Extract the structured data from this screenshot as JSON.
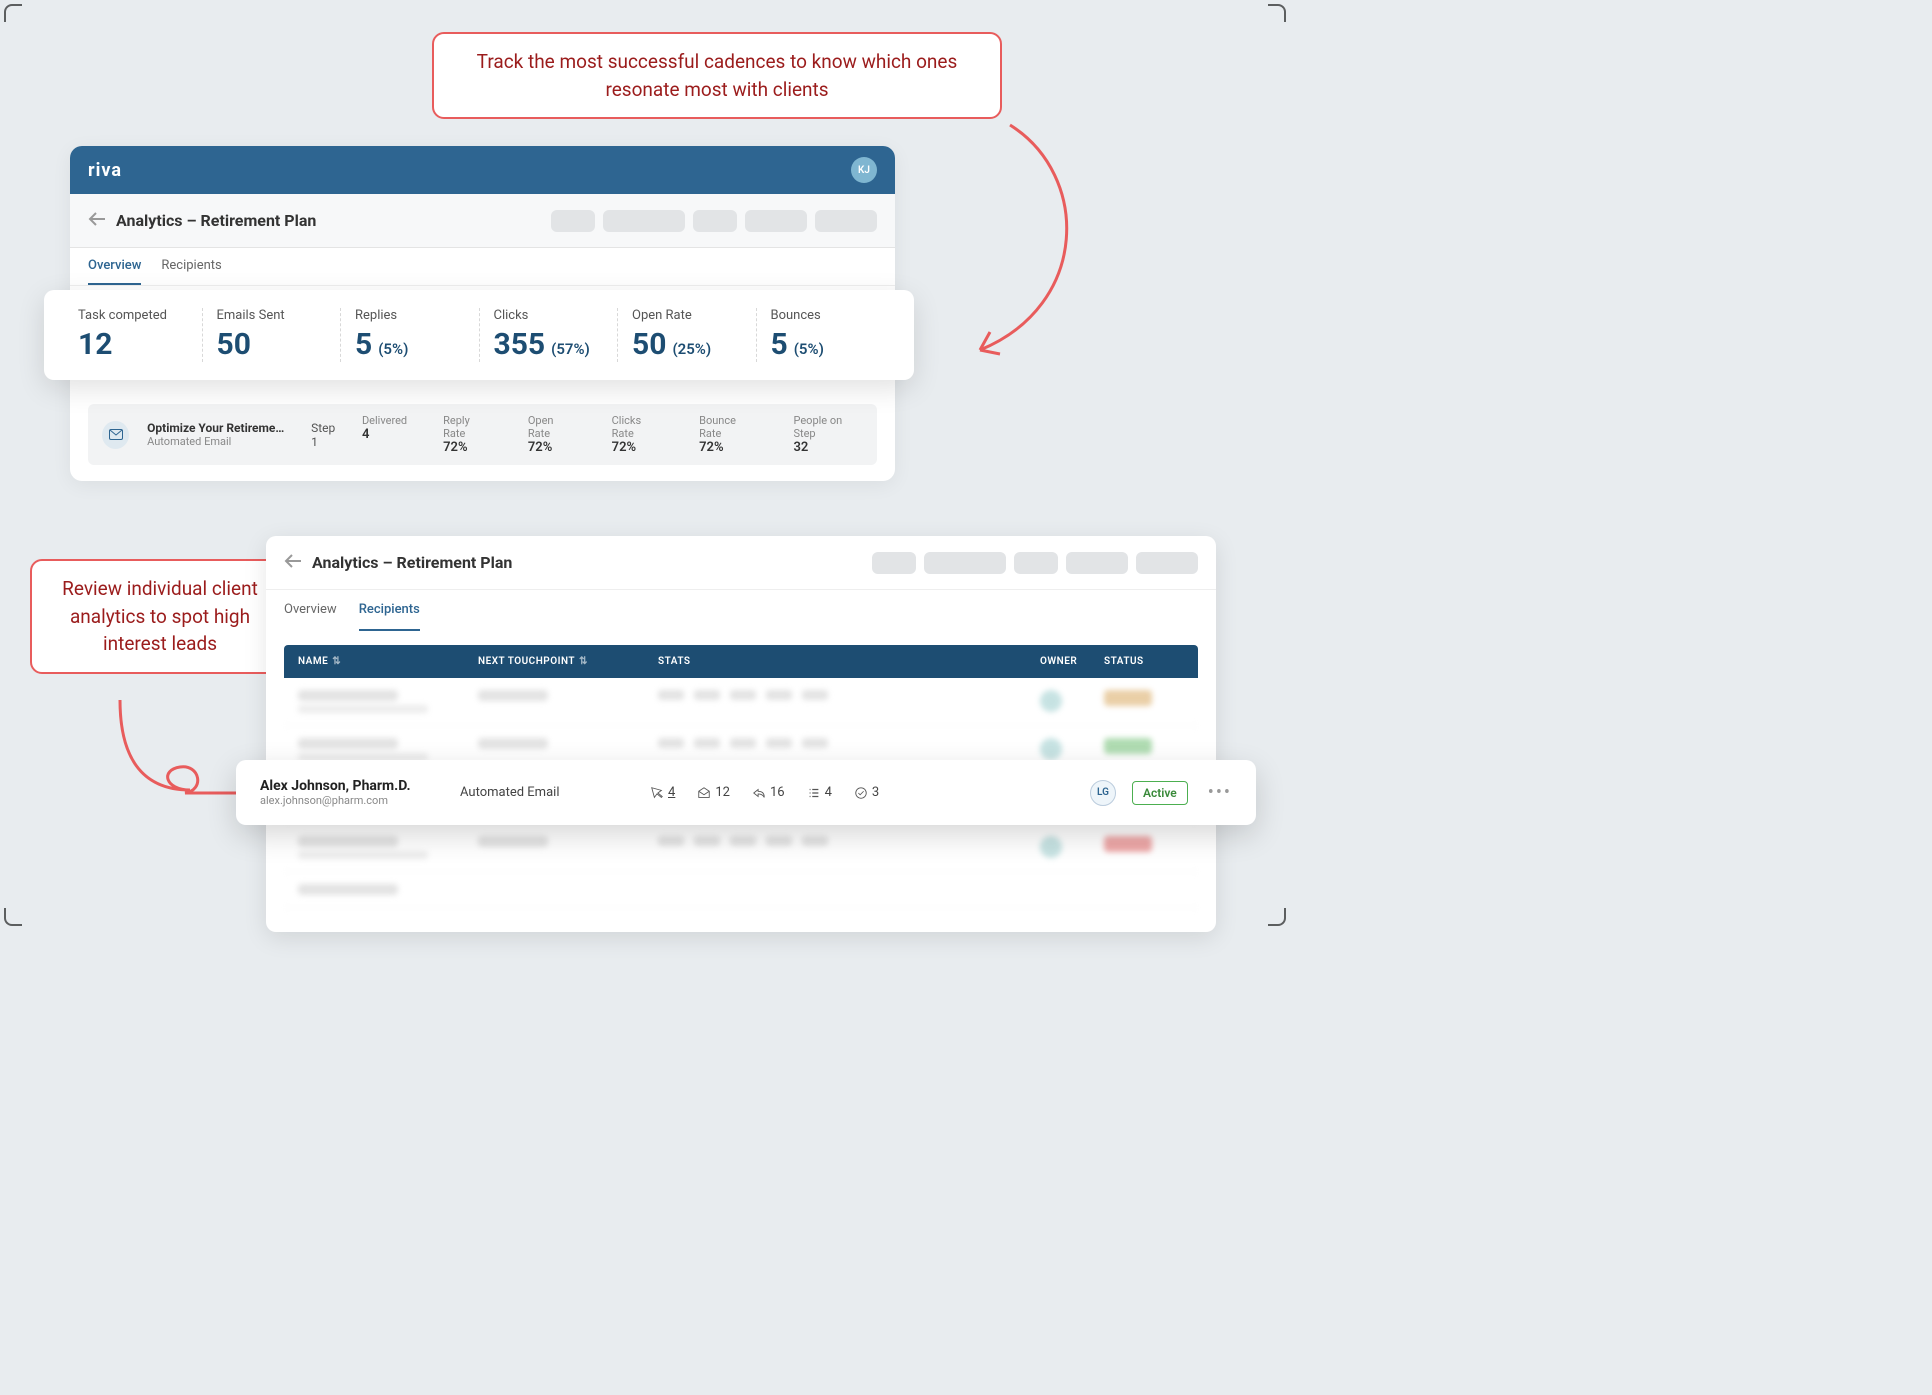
{
  "annotations": {
    "top": "Track the most successful cadences to know which ones resonate most with clients",
    "left": "Review individual client analytics to spot high interest leads"
  },
  "brand": {
    "logo": "riva",
    "avatar_initials": "KJ"
  },
  "page": {
    "title": "Analytics – Retirement Plan",
    "tabs": {
      "overview": "Overview",
      "recipients": "Recipients"
    }
  },
  "metrics": {
    "task_completed": {
      "label": "Task competed",
      "value": "12"
    },
    "emails_sent": {
      "label": "Emails Sent",
      "value": "50"
    },
    "replies": {
      "label": "Replies",
      "value": "5",
      "pct": "(5%)"
    },
    "clicks": {
      "label": "Clicks",
      "value": "355",
      "pct": "(57%)"
    },
    "open_rate": {
      "label": "Open Rate",
      "value": "50",
      "pct": "(25%)"
    },
    "bounces": {
      "label": "Bounces",
      "value": "5",
      "pct": "(5%)"
    }
  },
  "step": {
    "title": "Optimize Your Retirement P…",
    "subtitle": "Automated Email",
    "step_label": "Step 1",
    "delivered": {
      "label": "Delivered",
      "value": "4"
    },
    "reply_rate": {
      "label": "Reply Rate",
      "value": "72%"
    },
    "open_rate": {
      "label": "Open Rate",
      "value": "72%"
    },
    "clicks_rate": {
      "label": "Clicks Rate",
      "value": "72%"
    },
    "bounce_rate": {
      "label": "Bounce Rate",
      "value": "72%"
    },
    "people": {
      "label": "People on Step",
      "value": "32"
    }
  },
  "table": {
    "headers": {
      "name": "NAME",
      "next": "NEXT TOUCHPOINT",
      "stats": "STATS",
      "owner": "OWNER",
      "status": "STATUS"
    }
  },
  "recipient": {
    "name": "Alex Johnson, Pharm.D.",
    "email": "alex.johnson@pharm.com",
    "next_touchpoint": "Automated Email",
    "stats": {
      "clicks": "4",
      "opens": "12",
      "replies": "16",
      "tasks": "4",
      "completed": "3"
    },
    "owner_initials": "LG",
    "status": "Active"
  }
}
